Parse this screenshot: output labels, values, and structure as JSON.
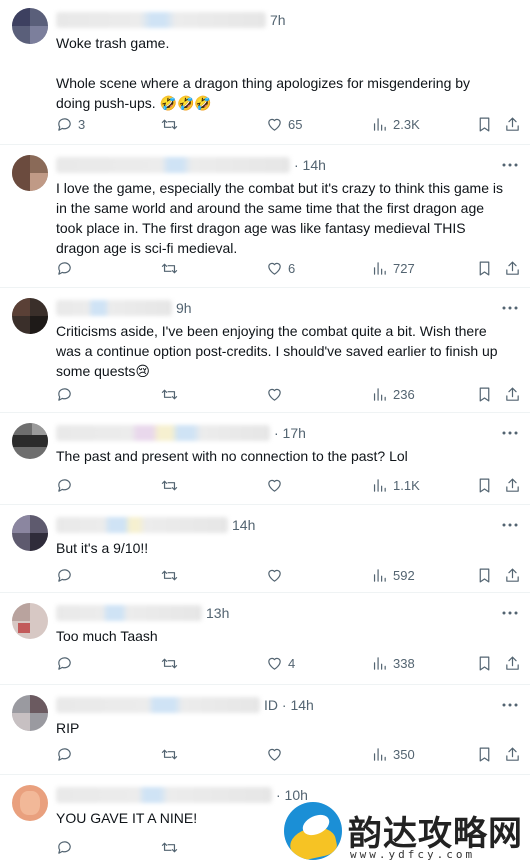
{
  "tweets": [
    {
      "time": "7h",
      "text": "Woke trash game.\n\nWhole scene where a dragon thing apologizes for misgendering by doing push-ups. 🤣🤣🤣",
      "replies": "3",
      "retweets": "",
      "likes": "65",
      "views": "2.3K"
    },
    {
      "time": "· 14h",
      "text": "I love the game, especially the combat but it's crazy to think this game is in the same world and around the same time that the first dragon age took place in. The first dragon age was like fantasy medieval THIS dragon age is sci-fi medieval.",
      "replies": "",
      "retweets": "",
      "likes": "6",
      "views": "727"
    },
    {
      "time": "9h",
      "text": "Criticisms aside, I've been enjoying the combat quite a bit. Wish there was a continue option post-credits. I should've saved earlier to finish up some quests😢",
      "replies": "",
      "retweets": "",
      "likes": "",
      "views": "236"
    },
    {
      "time": "· 17h",
      "text": "The past and present with no connection to the past? Lol",
      "replies": "",
      "retweets": "",
      "likes": "",
      "views": "1.1K"
    },
    {
      "time": "14h",
      "text": "But it's a 9/10!!",
      "replies": "",
      "retweets": "",
      "likes": "",
      "views": "592"
    },
    {
      "time": "13h",
      "text": "Too much Taash",
      "replies": "",
      "retweets": "",
      "likes": "4",
      "views": "338"
    },
    {
      "time": "ID · 14h",
      "text": "RIP",
      "replies": "",
      "retweets": "",
      "likes": "",
      "views": "350"
    },
    {
      "time": "· 10h",
      "text": "YOU GAVE IT A NINE!",
      "replies": "",
      "retweets": "",
      "likes": "",
      "views": ""
    }
  ],
  "watermark": {
    "brand": "韵达攻略网",
    "url": "www.ydfcy.com"
  },
  "icons": {
    "reply": "reply-icon",
    "retweet": "retweet-icon",
    "like": "heart-icon",
    "views": "views-icon",
    "bookmark": "bookmark-icon",
    "share": "share-icon",
    "more": "more-icon"
  }
}
